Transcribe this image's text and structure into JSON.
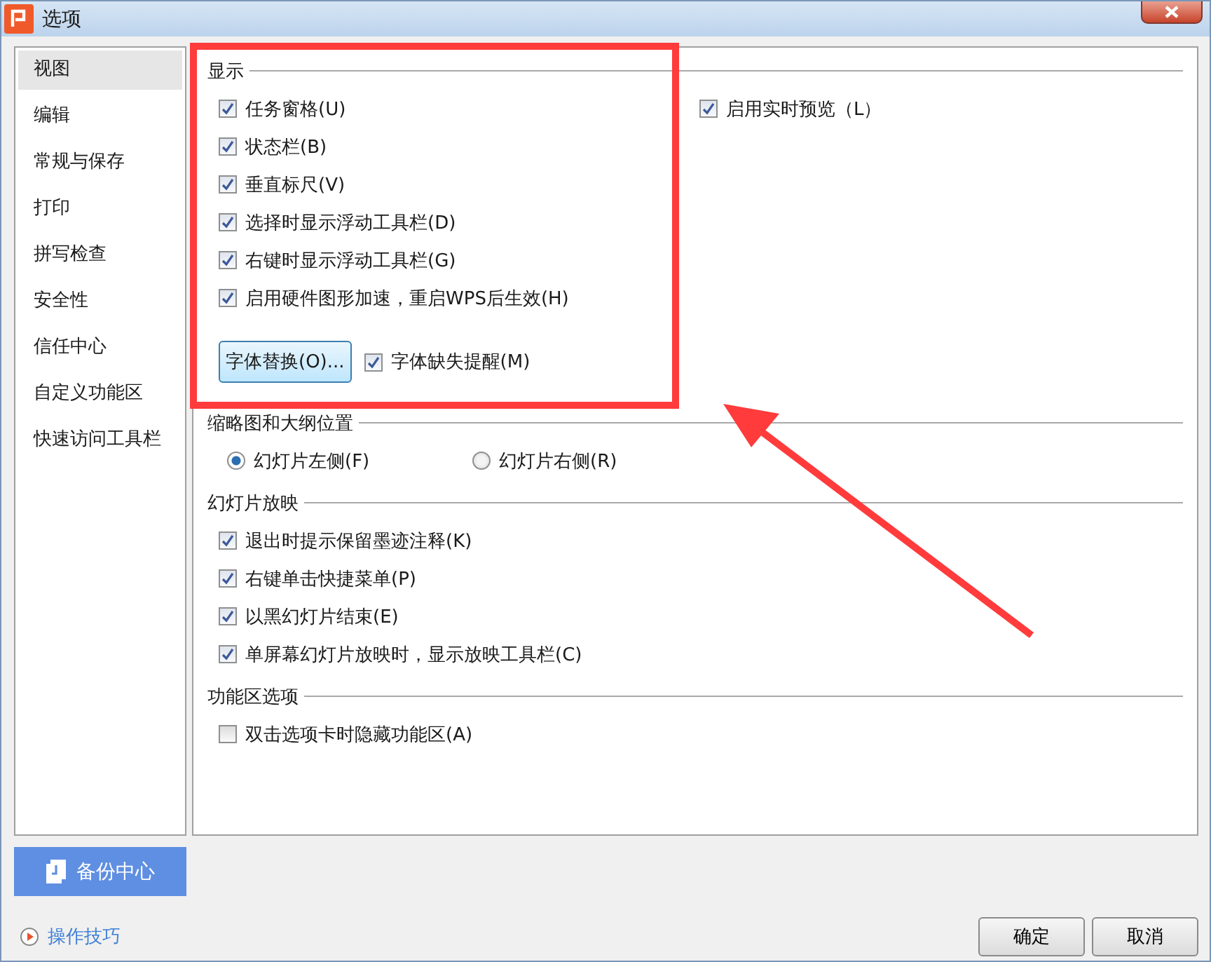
{
  "window": {
    "title": "选项"
  },
  "sidebar": {
    "items": [
      {
        "label": "视图",
        "selected": true
      },
      {
        "label": "编辑",
        "selected": false
      },
      {
        "label": "常规与保存",
        "selected": false
      },
      {
        "label": "打印",
        "selected": false
      },
      {
        "label": "拼写检查",
        "selected": false
      },
      {
        "label": "安全性",
        "selected": false
      },
      {
        "label": "信任中心",
        "selected": false
      },
      {
        "label": "自定义功能区",
        "selected": false
      },
      {
        "label": "快速访问工具栏",
        "selected": false
      }
    ]
  },
  "sections": [
    {
      "title": "显示",
      "rows": [
        {
          "kind": "two-column",
          "controls": [
            {
              "kind": "checkbox",
              "label": "任务窗格(U)",
              "checked": true
            },
            {
              "kind": "checkbox",
              "label": "启用实时预览（L）",
              "checked": true
            }
          ]
        },
        {
          "kind": "single",
          "controls": [
            {
              "kind": "checkbox",
              "label": "状态栏(B)",
              "checked": true
            }
          ]
        },
        {
          "kind": "single",
          "controls": [
            {
              "kind": "checkbox",
              "label": "垂直标尺(V)",
              "checked": true
            }
          ]
        },
        {
          "kind": "single",
          "controls": [
            {
              "kind": "checkbox",
              "label": "选择时显示浮动工具栏(D)",
              "checked": true
            }
          ]
        },
        {
          "kind": "single",
          "controls": [
            {
              "kind": "checkbox",
              "label": "右键时显示浮动工具栏(G)",
              "checked": true
            }
          ]
        },
        {
          "kind": "single",
          "controls": [
            {
              "kind": "checkbox",
              "label": "启用硬件图形加速，重启WPS后生效(H)",
              "checked": true
            }
          ]
        },
        {
          "kind": "button-row",
          "controls": [
            {
              "kind": "button",
              "label": "字体替换(O)..."
            },
            {
              "kind": "checkbox",
              "label": "字体缺失提醒(M)",
              "checked": true
            }
          ]
        }
      ]
    },
    {
      "title": "缩略图和大纲位置",
      "rows": [
        {
          "kind": "radio-pair",
          "controls": [
            {
              "kind": "radio",
              "label": "幻灯片左侧(F)",
              "selected": true
            },
            {
              "kind": "radio",
              "label": "幻灯片右侧(R)",
              "selected": false
            }
          ]
        }
      ]
    },
    {
      "title": "幻灯片放映",
      "rows": [
        {
          "kind": "single",
          "controls": [
            {
              "kind": "checkbox",
              "label": "退出时提示保留墨迹注释(K)",
              "checked": true
            }
          ]
        },
        {
          "kind": "single",
          "controls": [
            {
              "kind": "checkbox",
              "label": "右键单击快捷菜单(P)",
              "checked": true
            }
          ]
        },
        {
          "kind": "single",
          "controls": [
            {
              "kind": "checkbox",
              "label": "以黑幻灯片结束(E)",
              "checked": true
            }
          ]
        },
        {
          "kind": "single",
          "controls": [
            {
              "kind": "checkbox",
              "label": "单屏幕幻灯片放映时，显示放映工具栏(C)",
              "checked": true
            }
          ]
        }
      ]
    },
    {
      "title": "功能区选项",
      "rows": [
        {
          "kind": "single",
          "controls": [
            {
              "kind": "checkbox",
              "label": "双击选项卡时隐藏功能区(A)",
              "checked": false
            }
          ]
        }
      ]
    }
  ],
  "backup_button": "备份中心",
  "tips_link": "操作技巧",
  "buttons": [
    "确定",
    "取消"
  ]
}
